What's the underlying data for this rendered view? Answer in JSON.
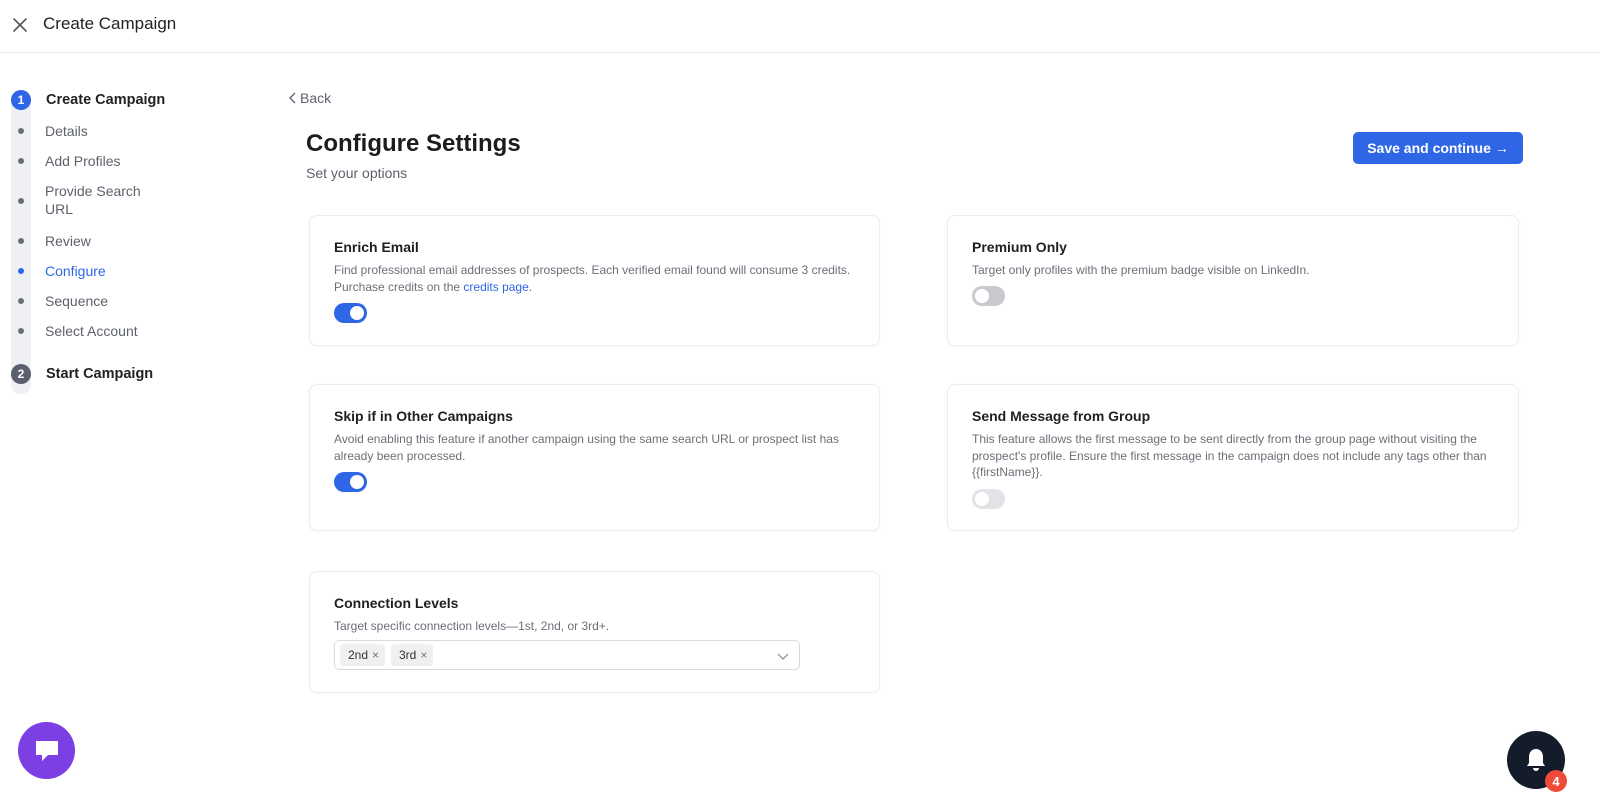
{
  "header": {
    "title": "Create Campaign",
    "close_icon": "close-icon"
  },
  "sidebar": {
    "steps": [
      {
        "number": "1",
        "title": "Create Campaign",
        "items": [
          {
            "label": "Details"
          },
          {
            "label": "Add Profiles"
          },
          {
            "label": "Provide Search URL"
          },
          {
            "label": "Review"
          },
          {
            "label": "Configure",
            "active": true
          },
          {
            "label": "Sequence"
          },
          {
            "label": "Select Account"
          }
        ]
      },
      {
        "number": "2",
        "title": "Start Campaign"
      }
    ]
  },
  "main": {
    "back_label": "Back",
    "title": "Configure Settings",
    "subtitle": "Set your options",
    "save_button": "Save and continue →",
    "accent_color": "#2f66e6",
    "cards": {
      "enrich_email": {
        "title": "Enrich Email",
        "desc": "Find professional email addresses of prospects. Each verified email found will consume 3 credits. Purchase credits on the ",
        "link": "credits page",
        "desc_end": ".",
        "toggle": "on"
      },
      "premium_only": {
        "title": "Premium Only",
        "desc": "Target only profiles with the premium badge visible on LinkedIn.",
        "toggle": "off"
      },
      "skip_other": {
        "title": "Skip if in Other Campaigns",
        "desc": "Avoid enabling this feature if another campaign using the same search URL or prospect list has already been processed.",
        "toggle": "on"
      },
      "send_group": {
        "title": "Send Message from Group",
        "desc": "This feature allows the first message to be sent directly from the group page without visiting the prospect's profile. Ensure the first message in the campaign does not include any tags other than {{firstName}}.",
        "toggle": "disabled"
      },
      "connection_levels": {
        "title": "Connection Levels",
        "desc": "Target specific connection levels—1st, 2nd, or 3rd+.",
        "selected": [
          "2nd",
          "3rd"
        ]
      }
    }
  },
  "floating": {
    "chat_icon": "chat-icon",
    "bell_icon": "bell-icon",
    "notification_count": "4"
  }
}
